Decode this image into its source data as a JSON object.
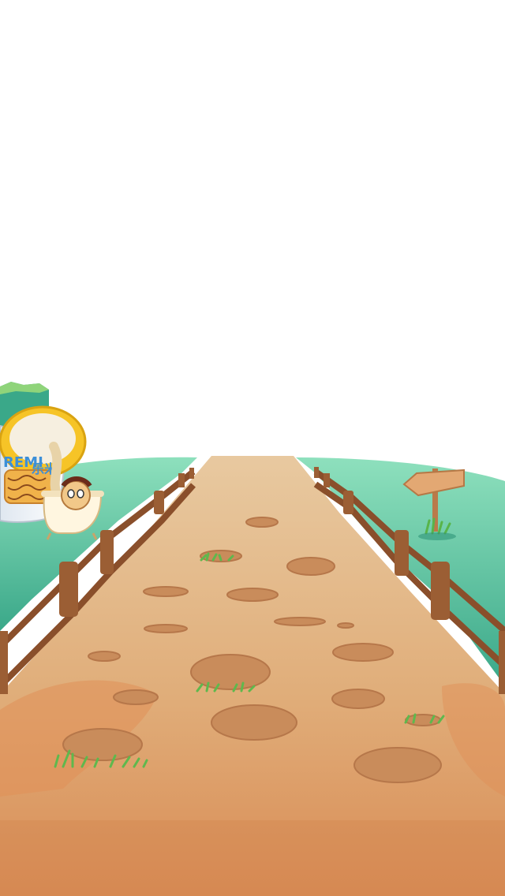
{
  "scene": {
    "type": "game-background",
    "description_visible_text": true
  },
  "product": {
    "brand": "REMI",
    "brand_cn": "乐米",
    "icon": "noodle-cup-icon"
  },
  "signpost": {
    "icon": "wooden-arrow-sign-icon",
    "direction": "left"
  },
  "colors": {
    "sky": "#ffffff",
    "grass": "#3fb895",
    "grass_light": "#7ed6b2",
    "path": "#e2b98a",
    "path_dark": "#d99a62",
    "stone": "#c98e5c",
    "fence": "#9b5e34",
    "cup_yellow": "#f6c427"
  }
}
